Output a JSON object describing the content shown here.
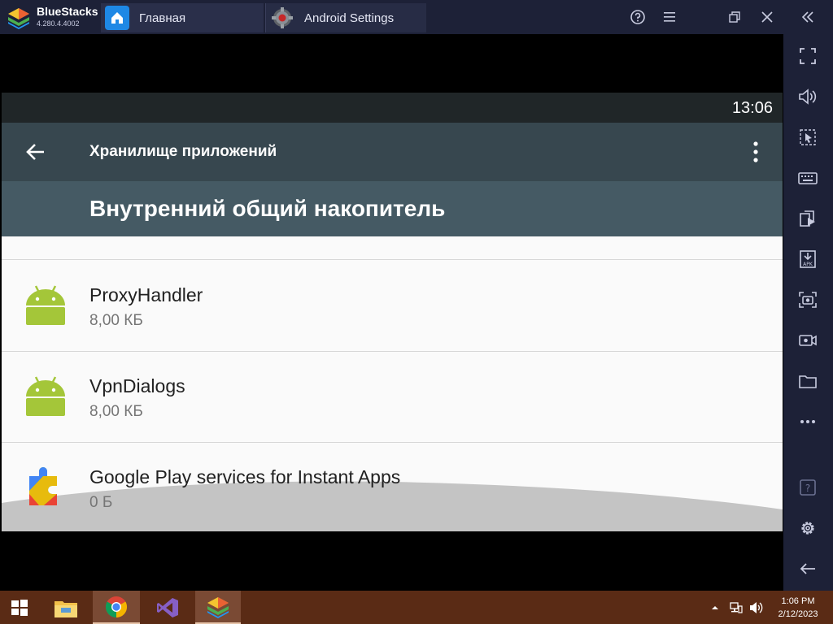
{
  "window": {
    "app_name": "BlueStacks",
    "version": "4.280.4.4002",
    "tabs": [
      {
        "label": "Главная",
        "icon": "home-icon"
      },
      {
        "label": "Android Settings",
        "icon": "gear-icon"
      }
    ],
    "controls": [
      "help-icon",
      "menu-icon",
      "restore-icon",
      "close-icon",
      "collapse-sidebar-icon"
    ]
  },
  "sidebar": {
    "buttons": [
      "fullscreen-icon",
      "volume-icon",
      "pointer-icon",
      "keyboard-icon",
      "media-manager-icon",
      "install-apk-icon",
      "screenshot-icon",
      "record-icon",
      "folder-icon",
      "more-icon",
      "help-icon",
      "settings-icon",
      "back-icon"
    ]
  },
  "android": {
    "status_time": "13:06",
    "appbar_title": "Хранилище приложений",
    "header_title": "Внутренний общий накопитель",
    "apps": [
      {
        "name": "ProxyHandler",
        "size": "8,00 КБ",
        "icon": "android-icon"
      },
      {
        "name": "VpnDialogs",
        "size": "8,00 КБ",
        "icon": "android-icon"
      },
      {
        "name": "Google Play services for Instant Apps",
        "size": "0 Б",
        "icon": "instant-apps-icon"
      }
    ]
  },
  "taskbar": {
    "items": [
      "windows-start-icon",
      "file-explorer-icon",
      "chrome-icon",
      "visual-studio-icon",
      "bluestacks-icon"
    ],
    "clock_time": "1:06 PM",
    "clock_date": "2/12/2023"
  },
  "colors": {
    "titlebar": "#1d2137",
    "appbar": "#37474f",
    "header": "#455a64",
    "android_green": "#a4c639",
    "taskbar": "#5a2b15"
  }
}
